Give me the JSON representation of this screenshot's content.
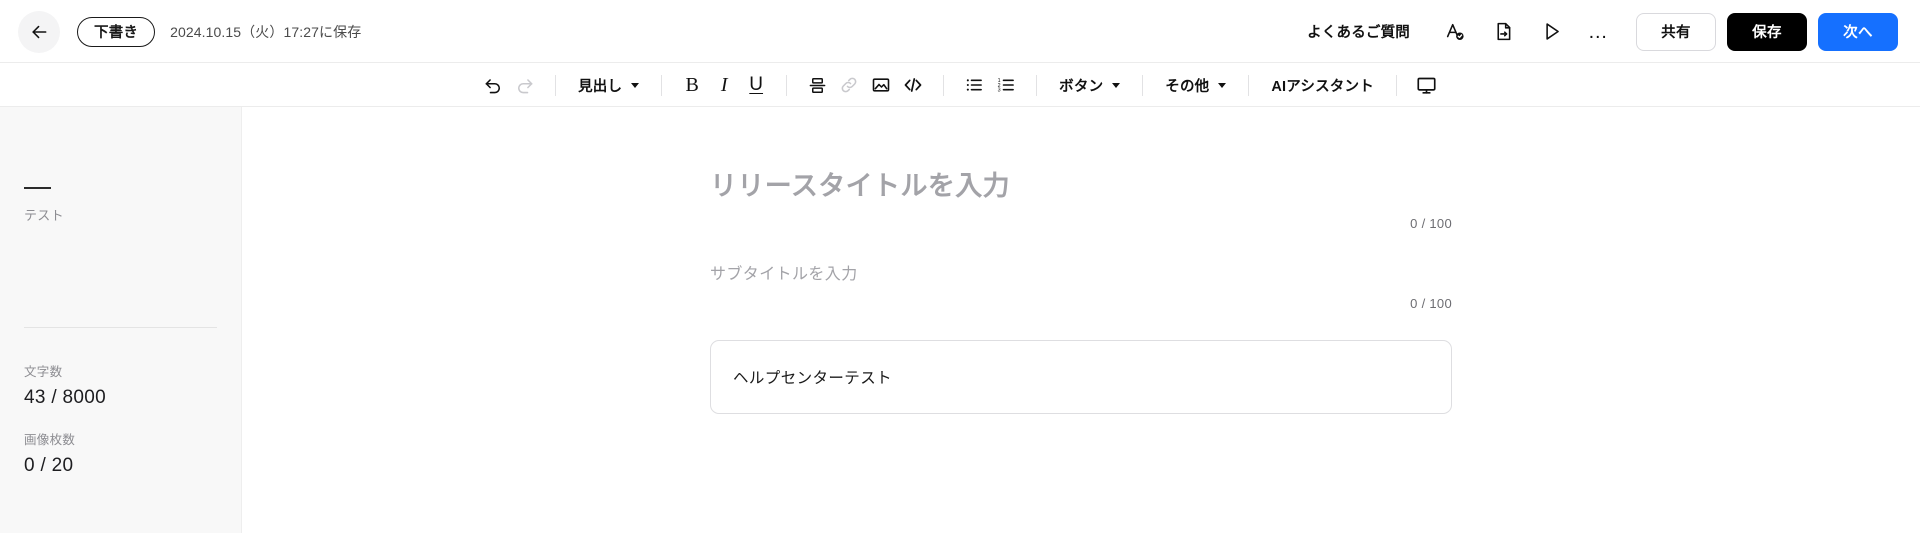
{
  "header": {
    "back_icon": "arrow-left-icon",
    "status_badge": "下書き",
    "saved_at": "2024.10.15（火）17:27に保存",
    "faq_link": "よくあるご質問",
    "spellcheck_icon": "spellcheck-icon",
    "export_icon": "document-export-icon",
    "preview_icon": "play-icon",
    "more_icon": "ellipsis-icon",
    "more_label": "…",
    "share_label": "共有",
    "save_label": "保存",
    "next_label": "次へ",
    "accent_color": "#1570ff",
    "save_bg_color": "#000000"
  },
  "toolbar": {
    "undo_icon": "undo-icon",
    "redo_icon": "redo-icon",
    "heading_label": "見出し",
    "bold_label": "B",
    "italic_label": "I",
    "underline_label": "U",
    "divider_icon": "horizontal-rule-icon",
    "link_icon": "link-icon",
    "image_icon": "image-icon",
    "code_label": "</>",
    "bullet_list_icon": "bullet-list-icon",
    "numbered_list_icon": "numbered-list-icon",
    "button_label": "ボタン",
    "other_label": "その他",
    "ai_assistant_label": "AIアシスタント",
    "preview_device_icon": "monitor-icon"
  },
  "sidebar": {
    "doc_name": "テスト",
    "stats": [
      {
        "label": "文字数",
        "value": "43 / 8000"
      },
      {
        "label": "画像枚数",
        "value": "0 / 20"
      }
    ]
  },
  "editor": {
    "title_placeholder": "リリースタイトルを入力",
    "title_count": "0 / 100",
    "subtitle_placeholder": "サブタイトルを入力",
    "subtitle_count": "0 / 100",
    "body_text": "ヘルプセンターテスト"
  }
}
